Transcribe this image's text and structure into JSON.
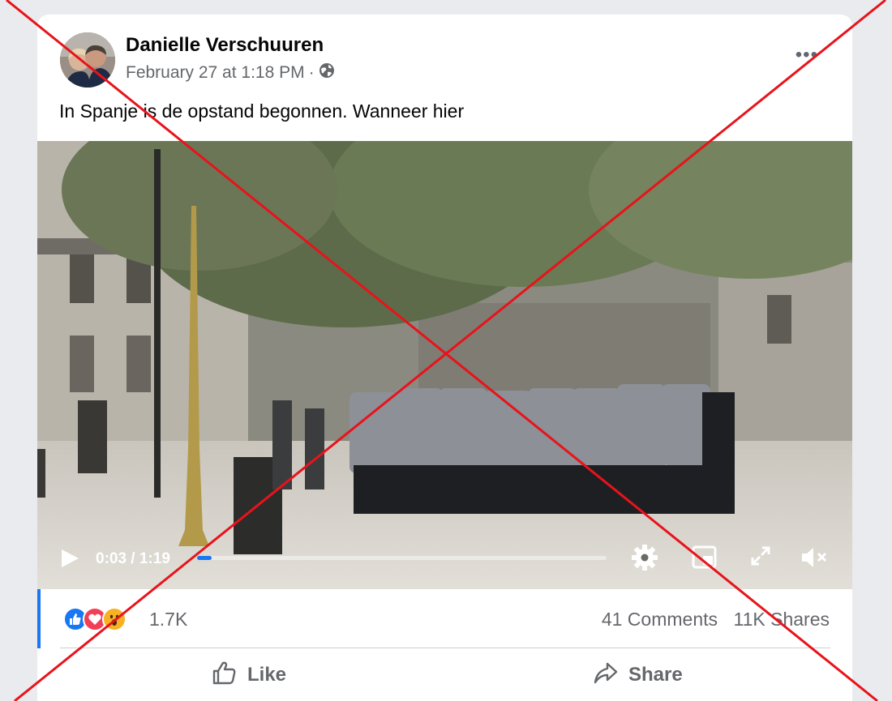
{
  "post": {
    "author": "Danielle Verschuuren",
    "timestamp": "February 27 at 1:18 PM",
    "separator": "·",
    "privacy_icon": "globe-icon",
    "more_label": "•••",
    "text": "In Spanje is de opstand begonnen.  Wanneer hier"
  },
  "video": {
    "time": "0:03 / 1:19",
    "progress": 0.035,
    "icons": [
      "play-icon",
      "gear-icon",
      "miniplayer-icon",
      "fullscreen-icon",
      "mute-icon"
    ]
  },
  "stats": {
    "reactions": [
      "like-icon",
      "love-icon",
      "wow-icon"
    ],
    "reaction_count": "1.7K",
    "comments": "41 Comments",
    "shares": "11K Shares"
  },
  "actions": {
    "like": "Like",
    "share": "Share"
  },
  "colors": {
    "accent": "#1877f2",
    "cross": "#e8131b"
  }
}
